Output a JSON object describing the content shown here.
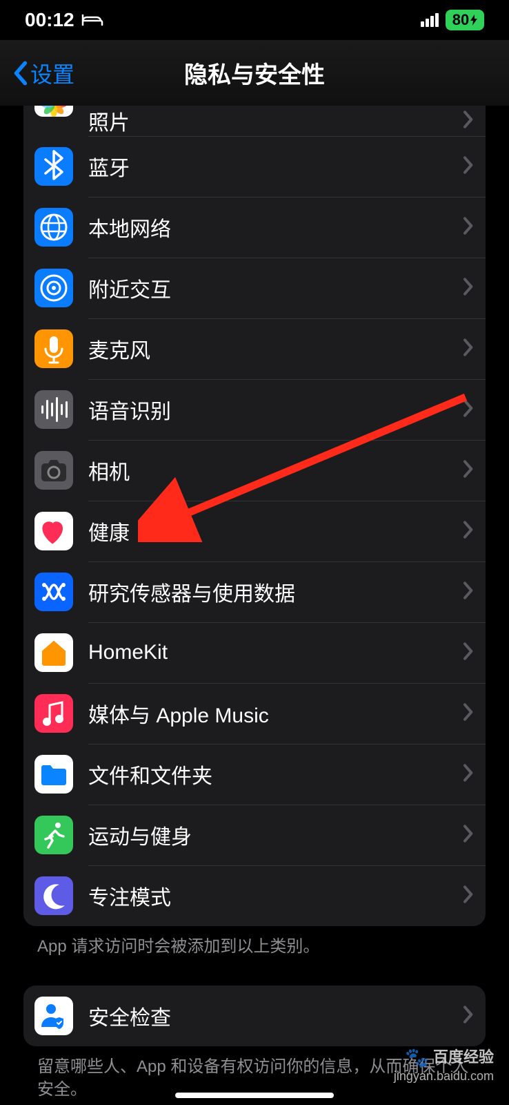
{
  "status": {
    "time": "00:12",
    "battery": "80",
    "battery_suffix": "⚡"
  },
  "nav": {
    "back_label": "设置",
    "title": "隐私与安全性"
  },
  "list": {
    "items": [
      {
        "label": "照片",
        "icon": "photos",
        "bg": "#ffffff"
      },
      {
        "label": "蓝牙",
        "icon": "bluetooth",
        "bg": "#0a7cff"
      },
      {
        "label": "本地网络",
        "icon": "globe",
        "bg": "#0a7cff"
      },
      {
        "label": "附近交互",
        "icon": "target",
        "bg": "#0a7cff"
      },
      {
        "label": "麦克风",
        "icon": "mic",
        "bg": "#ff9500"
      },
      {
        "label": "语音识别",
        "icon": "waveform",
        "bg": "#5a5a5e"
      },
      {
        "label": "相机",
        "icon": "camera",
        "bg": "#5a5a5e"
      },
      {
        "label": "健康",
        "icon": "heart",
        "bg": "#ffffff"
      },
      {
        "label": "研究传感器与使用数据",
        "icon": "sensor",
        "bg": "#0a64ff"
      },
      {
        "label": "HomeKit",
        "icon": "home",
        "bg": "#ffffff"
      },
      {
        "label": "媒体与 Apple Music",
        "icon": "music",
        "bg": "#ff2d55"
      },
      {
        "label": "文件和文件夹",
        "icon": "folder",
        "bg": "#ffffff"
      },
      {
        "label": "运动与健身",
        "icon": "runner",
        "bg": "#34c759"
      },
      {
        "label": "专注模式",
        "icon": "moon",
        "bg": "#5e5ce6"
      }
    ],
    "footer": "App 请求访问时会被添加到以上类别。"
  },
  "group2": {
    "items": [
      {
        "label": "安全检查",
        "icon": "safety",
        "bg": "#ffffff"
      }
    ],
    "footer": "留意哪些人、App 和设备有权访问你的信息，从而确保个人安全。"
  },
  "watermark": {
    "brand": "百度经验",
    "url": "jingyan.baidu.com"
  },
  "colors": {
    "accent": "#0a84ff",
    "arrow": "#ff3b30"
  }
}
